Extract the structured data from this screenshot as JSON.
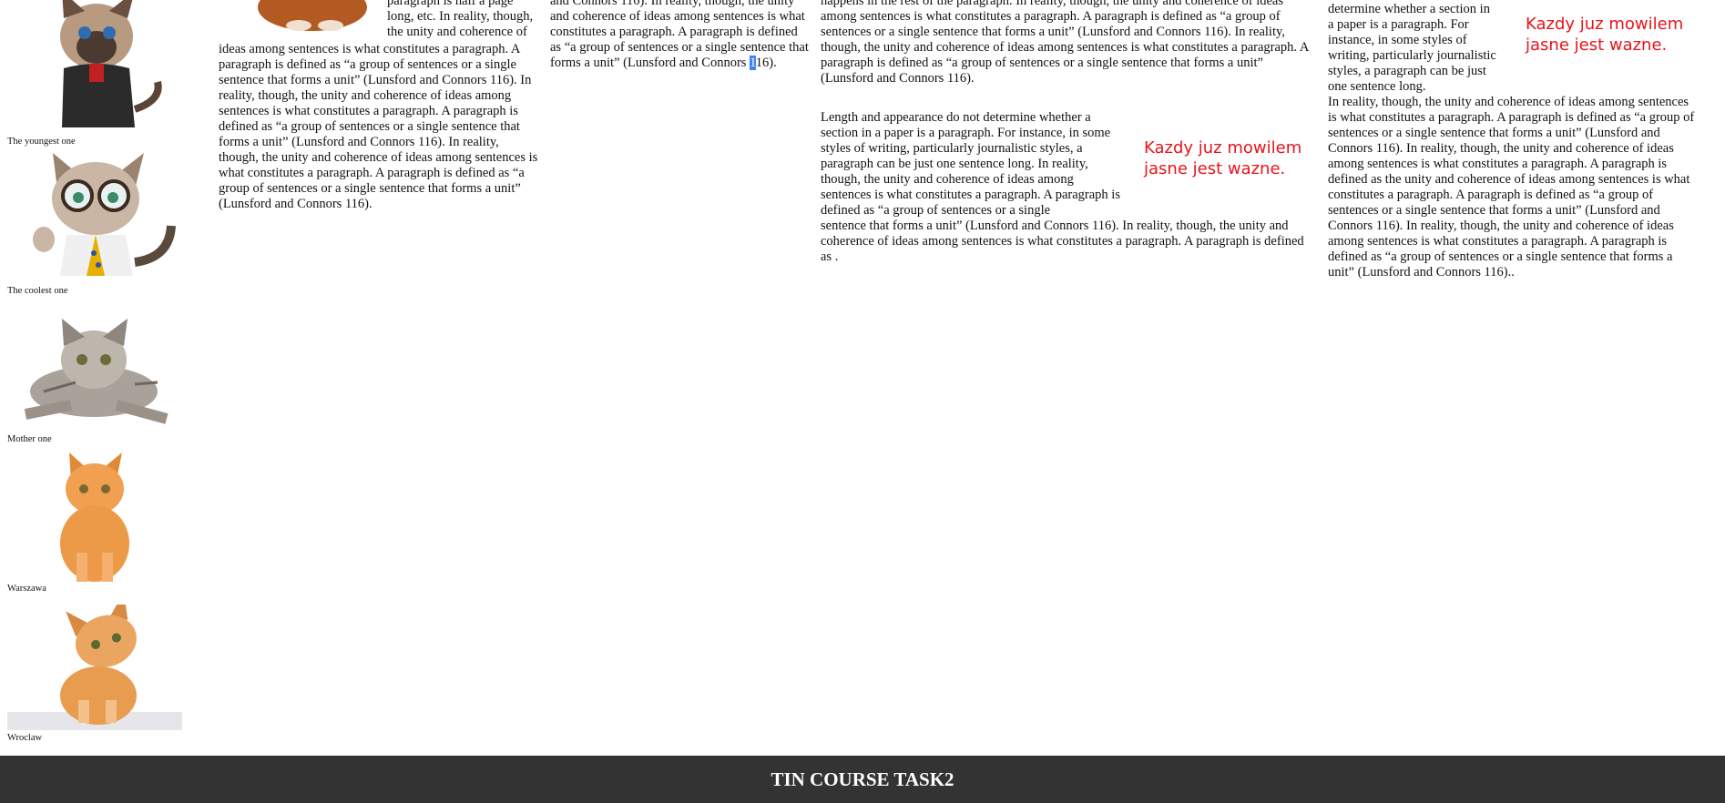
{
  "sidebar": {
    "items": [
      {
        "caption": "The youngest one",
        "icon": "siamese-cat-in-jacket-icon"
      },
      {
        "caption": "The coolest one",
        "icon": "cat-with-glasses-in-tie-icon"
      },
      {
        "caption": "Mother one",
        "icon": "crouching-tabby-kitten-icon"
      },
      {
        "caption": "Warszawa",
        "icon": "sitting-orange-kitten-icon"
      },
      {
        "caption": "Wroclaw",
        "icon": "tilting-head-kitten-icon"
      }
    ]
  },
  "col1": {
    "text_top": "paragraph is half a page long, etc. In reality, though, the unity and coherence of",
    "text_rest": "ideas among sentences is what constitutes a paragraph. A paragraph is defined as “a group of sentences or a single sentence that forms a unit” (Lunsford and Connors 116). In reality, though, the unity and coherence of ideas among sentences is what constitutes a paragraph. A paragraph is defined as “a group of sentences or a single sentence that forms a unit” (Lunsford and Connors 116). In reality, though, the unity and coherence of ideas among sentences is what constitutes a paragraph. A paragraph is defined as “a group of sentences or a single sentence that forms a unit” (Lunsford and Connors 116)."
  },
  "col2": {
    "text": "and Connors 116). In reality, though, the unity and coherence of ideas among sentences is what constitutes a paragraph. A paragraph is defined as “a group of sentences or a single sentence that forms a unit” (Lunsford and Connors ",
    "selected": "1",
    "text_end": "16)."
  },
  "col3": {
    "p1": "happens in the rest of the paragraph. In reality, though, the unity and coherence of ideas among sentences is what constitutes a paragraph. A paragraph is defined as “a group of sentences or a single sentence that forms a unit” (Lunsford and Connors 116). In reality, though, the unity and coherence of ideas among sentences is what constitutes a paragraph. A paragraph is defined as “a group of sentences or a single sentence that forms a unit” (Lunsford and Connors 116).",
    "p2_wrapped": "Length and appearance do not determine whether a section in a paper is a paragraph. For instance, in some styles of writing, particularly journalistic styles, a paragraph can be just one sentence long. In reality, though, the unity and coherence of ideas among sentences is what constitutes a paragraph. A paragraph is defined as “a group of sentences or a single",
    "p2_full": "sentence that forms a unit” (Lunsford and Connors 116). In reality, though, the unity and coherence of ideas among sentences is what constitutes a paragraph. A paragraph is defined as .",
    "note_line1": "Kazdy juz mowilem",
    "note_line2": "jasne jest wazne."
  },
  "col4": {
    "p_wrapped": "determine whether a section in a paper is a paragraph. For instance, in some styles of writing, particularly journalistic styles, a paragraph can be just one sentence long.",
    "p_full": "In reality, though, the unity and coherence of ideas among sentences is what constitutes a paragraph. A paragraph is defined as “a group of sentences or a single sentence that forms a unit” (Lunsford and Connors 116). In reality, though, the unity and coherence of ideas among sentences is what constitutes a paragraph. A paragraph is defined as the unity and coherence of ideas among sentences is what constitutes a paragraph. A paragraph is defined as “a group of sentences or a single sentence that forms a unit” (Lunsford and Connors 116). In reality, though, the unity and coherence of ideas among sentences is what constitutes a paragraph. A paragraph is defined as “a group of sentences or a single sentence that forms a unit” (Lunsford and Connors 116)..",
    "note_line1": "Kazdy juz mowilem",
    "note_line2": "jasne jest wazne."
  },
  "footer": {
    "title": "TIN COURSE TASK2"
  }
}
